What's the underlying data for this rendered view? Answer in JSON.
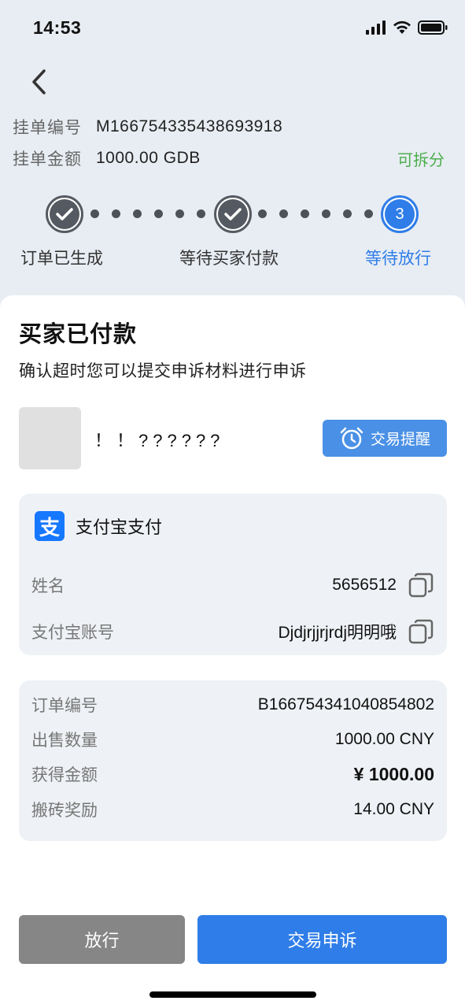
{
  "status": {
    "time": "14:53"
  },
  "listing": {
    "order_label": "挂单编号",
    "order_value": "M166754335438693918",
    "amount_label": "挂单金额",
    "amount_value": "1000.00 GDB",
    "split_label": "可拆分"
  },
  "steps": [
    {
      "label": "订单已生成",
      "state": "done"
    },
    {
      "label": "等待买家付款",
      "state": "done"
    },
    {
      "label": "等待放行",
      "state": "active",
      "number": "3"
    }
  ],
  "sheet": {
    "title": "买家已付款",
    "subtitle": "确认超时您可以提交申诉材料进行申诉"
  },
  "buyer": {
    "nickname": "！！??????",
    "remind_button": "交易提醒"
  },
  "payment": {
    "logo_char": "支",
    "method": "支付宝支付",
    "name_label": "姓名",
    "name_value": "5656512",
    "account_label": "支付宝账号",
    "account_value": "Djdjrjjrjrdj明明哦"
  },
  "order": {
    "rows": [
      {
        "label": "订单编号",
        "value": "B166754341040854802"
      },
      {
        "label": "出售数量",
        "value": "1000.00 CNY"
      },
      {
        "label": "获得金额",
        "value": "¥ 1000.00"
      },
      {
        "label": "搬砖奖励",
        "value": "14.00 CNY"
      }
    ]
  },
  "actions": {
    "release": "放行",
    "appeal": "交易申诉"
  },
  "colors": {
    "accent": "#2f7de8",
    "success": "#4cae4c",
    "alipay": "#1677ff"
  }
}
